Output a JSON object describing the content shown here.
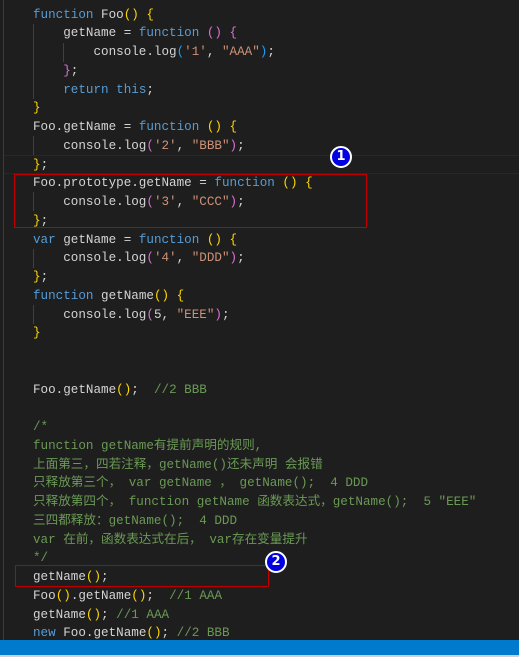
{
  "colors": {
    "background": "#1e1e1e",
    "keyword": "#569cd6",
    "string": "#ce9178",
    "comment": "#6a9955",
    "text": "#d4d4d4",
    "statusbar": "#007acc",
    "annotation_box": "#c00000",
    "badge": "#0000e0"
  },
  "annotations": {
    "badge1": "1",
    "badge2": "2"
  },
  "code_lines": [
    [
      [
        "function",
        "kw"
      ],
      [
        " Foo",
        "tx"
      ],
      [
        "()",
        "b1"
      ],
      [
        " ",
        "tx"
      ],
      [
        "{",
        "b1"
      ]
    ],
    [
      [
        "    getName = ",
        "tx"
      ],
      [
        "function",
        "kw"
      ],
      [
        " ",
        "tx"
      ],
      [
        "()",
        "b2"
      ],
      [
        " ",
        "tx"
      ],
      [
        "{",
        "b2"
      ]
    ],
    [
      [
        "        console.log",
        "tx"
      ],
      [
        "(",
        "b3"
      ],
      [
        "'1'",
        "str"
      ],
      [
        ", ",
        "tx"
      ],
      [
        "\"AAA\"",
        "str"
      ],
      [
        ")",
        "b3"
      ],
      [
        ";",
        "tx"
      ]
    ],
    [
      [
        "    ",
        "tx"
      ],
      [
        "}",
        "b2"
      ],
      [
        ";",
        "tx"
      ]
    ],
    [
      [
        "    ",
        "tx"
      ],
      [
        "return",
        "kw"
      ],
      [
        " ",
        "tx"
      ],
      [
        "this",
        "kw"
      ],
      [
        ";",
        "tx"
      ]
    ],
    [
      [
        "}",
        "b1"
      ]
    ],
    [
      [
        "Foo.getName = ",
        "tx"
      ],
      [
        "function",
        "kw"
      ],
      [
        " ",
        "tx"
      ],
      [
        "()",
        "b1"
      ],
      [
        " ",
        "tx"
      ],
      [
        "{",
        "b1"
      ]
    ],
    [
      [
        "    console.log",
        "tx"
      ],
      [
        "(",
        "b2"
      ],
      [
        "'2'",
        "str"
      ],
      [
        ", ",
        "tx"
      ],
      [
        "\"BBB\"",
        "str"
      ],
      [
        ")",
        "b2"
      ],
      [
        ";",
        "tx"
      ]
    ],
    [
      [
        "}",
        "b1"
      ],
      [
        ";",
        "tx"
      ]
    ],
    [
      [
        "Foo.prototype.getName = ",
        "tx"
      ],
      [
        "function",
        "kw"
      ],
      [
        " ",
        "tx"
      ],
      [
        "()",
        "b1"
      ],
      [
        " ",
        "tx"
      ],
      [
        "{",
        "b1"
      ]
    ],
    [
      [
        "    console.log",
        "tx"
      ],
      [
        "(",
        "b2"
      ],
      [
        "'3'",
        "str"
      ],
      [
        ", ",
        "tx"
      ],
      [
        "\"CCC\"",
        "str"
      ],
      [
        ")",
        "b2"
      ],
      [
        ";",
        "tx"
      ]
    ],
    [
      [
        "}",
        "b1"
      ],
      [
        ";",
        "tx"
      ]
    ],
    [
      [
        "var",
        "kw"
      ],
      [
        " getName = ",
        "tx"
      ],
      [
        "function",
        "kw"
      ],
      [
        " ",
        "tx"
      ],
      [
        "()",
        "b1"
      ],
      [
        " ",
        "tx"
      ],
      [
        "{",
        "b1"
      ]
    ],
    [
      [
        "    console.log",
        "tx"
      ],
      [
        "(",
        "b2"
      ],
      [
        "'4'",
        "str"
      ],
      [
        ", ",
        "tx"
      ],
      [
        "\"DDD\"",
        "str"
      ],
      [
        ")",
        "b2"
      ],
      [
        ";",
        "tx"
      ]
    ],
    [
      [
        "}",
        "b1"
      ],
      [
        ";",
        "tx"
      ]
    ],
    [
      [
        "function",
        "kw"
      ],
      [
        " getName",
        "tx"
      ],
      [
        "()",
        "b1"
      ],
      [
        " ",
        "tx"
      ],
      [
        "{",
        "b1"
      ]
    ],
    [
      [
        "    console.log",
        "tx"
      ],
      [
        "(",
        "b2"
      ],
      [
        "5, ",
        "tx"
      ],
      [
        "\"EEE\"",
        "str"
      ],
      [
        ")",
        "b2"
      ],
      [
        ";",
        "tx"
      ]
    ],
    [
      [
        "}",
        "b1"
      ]
    ],
    [],
    [],
    [
      [
        "Foo.getName",
        "tx"
      ],
      [
        "()",
        "b1"
      ],
      [
        ";  ",
        "tx"
      ],
      [
        "//2 BBB",
        "cm"
      ]
    ],
    [],
    [
      [
        "/*",
        "cm"
      ]
    ],
    [
      [
        "function getName有提前声明的规则,",
        "cm"
      ]
    ],
    [
      [
        "上面第三，四若注释，getName()还未声明 会报错",
        "cm"
      ]
    ],
    [
      [
        "只释放第三个， var getName ， getName();  4 DDD",
        "cm"
      ]
    ],
    [
      [
        "只释放第四个， function getName 函数表达式，getName();  5 \"EEE\"",
        "cm"
      ]
    ],
    [
      [
        "三四都释放：getName();  4 DDD",
        "cm"
      ]
    ],
    [
      [
        "var 在前，函数表达式在后， var存在变量提升",
        "cm"
      ]
    ],
    [
      [
        "*/",
        "cm"
      ]
    ],
    [
      [
        "getName",
        "tx"
      ],
      [
        "()",
        "b1"
      ],
      [
        ";",
        "tx"
      ]
    ],
    [
      [
        "Foo",
        "tx"
      ],
      [
        "()",
        "b1"
      ],
      [
        ".getName",
        "tx"
      ],
      [
        "()",
        "b1"
      ],
      [
        ";  ",
        "tx"
      ],
      [
        "//1 AAA",
        "cm"
      ]
    ],
    [
      [
        "getName",
        "tx"
      ],
      [
        "()",
        "b1"
      ],
      [
        "; ",
        "tx"
      ],
      [
        "//1 AAA",
        "cm"
      ]
    ],
    [
      [
        "new",
        "kw"
      ],
      [
        " Foo.getName",
        "tx"
      ],
      [
        "()",
        "b1"
      ],
      [
        "; ",
        "tx"
      ],
      [
        "//2 BBB",
        "cm"
      ]
    ]
  ]
}
